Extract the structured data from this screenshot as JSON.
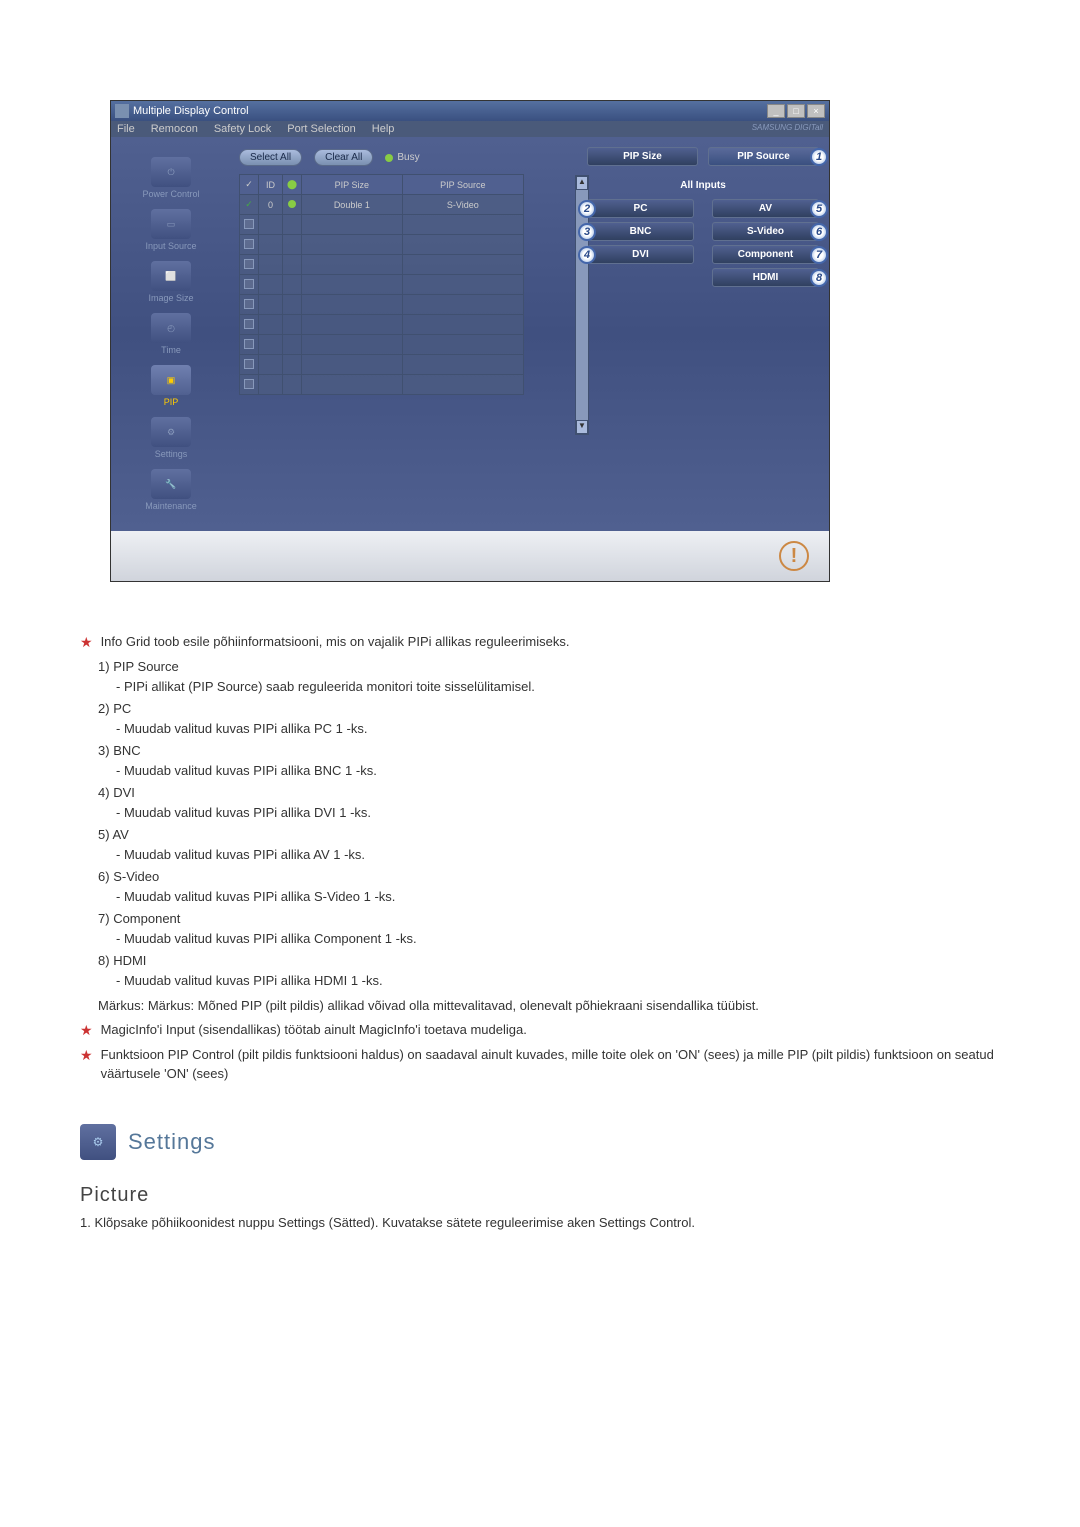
{
  "window": {
    "title": "Multiple Display Control",
    "menubar": [
      "File",
      "Remocon",
      "Safety Lock",
      "Port Selection",
      "Help"
    ],
    "brand": "SAMSUNG DIGITall"
  },
  "sidebar": {
    "items": [
      {
        "label": "Power Control"
      },
      {
        "label": "Input Source"
      },
      {
        "label": "Image Size"
      },
      {
        "label": "Time"
      },
      {
        "label": "PIP"
      },
      {
        "label": "Settings"
      },
      {
        "label": "Maintenance"
      }
    ]
  },
  "toolbar": {
    "select_all": "Select All",
    "clear_all": "Clear All",
    "busy": "Busy"
  },
  "grid": {
    "headers": {
      "check": "✓",
      "id": "ID",
      "status": "",
      "pip_size": "PIP Size",
      "pip_source": "PIP Source"
    },
    "rows": [
      {
        "checked": true,
        "id": "0",
        "status": "on",
        "pip_size": "Double 1",
        "pip_source": "S-Video"
      }
    ],
    "empty_rows": 8
  },
  "panel": {
    "pip_size": "PIP Size",
    "pip_source": "PIP Source",
    "all_inputs": "All Inputs",
    "buttons": [
      {
        "label": "PC",
        "badge": "2",
        "side": "left"
      },
      {
        "label": "AV",
        "badge": "5",
        "side": "right"
      },
      {
        "label": "BNC",
        "badge": "3",
        "side": "left"
      },
      {
        "label": "S-Video",
        "badge": "6",
        "side": "right"
      },
      {
        "label": "DVI",
        "badge": "4",
        "side": "left"
      },
      {
        "label": "Component",
        "badge": "7",
        "side": "right"
      },
      {
        "label": "HDMI",
        "badge": "8",
        "side": "right"
      }
    ]
  },
  "doc": {
    "intro_star": "Info Grid toob esile põhiinformatsiooni, mis on vajalik PIPi allikas reguleerimiseks.",
    "items": [
      {
        "num": "1)",
        "title": "PIP Source",
        "desc": "- PIPi allikat (PIP Source) saab reguleerida monitori toite sisselülitamisel."
      },
      {
        "num": "2)",
        "title": "PC",
        "desc": "- Muudab valitud kuvas PIPi allika PC 1 -ks."
      },
      {
        "num": "3)",
        "title": "BNC",
        "desc": "- Muudab valitud kuvas PIPi allika BNC 1 -ks."
      },
      {
        "num": "4)",
        "title": "DVI",
        "desc": "- Muudab valitud kuvas PIPi allika DVI 1 -ks."
      },
      {
        "num": "5)",
        "title": "AV",
        "desc": "- Muudab valitud kuvas PIPi allika AV 1 -ks."
      },
      {
        "num": "6)",
        "title": "S-Video",
        "desc": "- Muudab valitud kuvas PIPi allika S-Video 1 -ks."
      },
      {
        "num": "7)",
        "title": "Component",
        "desc": "- Muudab valitud kuvas PIPi allika Component 1 -ks."
      },
      {
        "num": "8)",
        "title": "HDMI",
        "desc": "- Muudab valitud kuvas PIPi allika HDMI 1 -ks."
      }
    ],
    "note": "Märkus: Märkus: Mõned PIP (pilt pildis) allikad võivad olla mittevalitavad, olenevalt põhiekraani sisendallika tüübist.",
    "star2": "MagicInfo'i Input (sisendallikas) töötab ainult MagicInfo'i toetava mudeliga.",
    "star3": "Funktsioon PIP Control (pilt pildis funktsiooni haldus) on saadaval ainult kuvades, mille toite olek on 'ON' (sees) ja mille PIP (pilt pildis) funktsioon on seatud väärtusele 'ON' (sees)"
  },
  "settings": {
    "title": "Settings",
    "picture_title": "Picture",
    "picture_desc": "1. Klõpsake põhiikoonidest nuppu Settings (Sätted). Kuvatakse sätete reguleerimise aken Settings Control."
  }
}
